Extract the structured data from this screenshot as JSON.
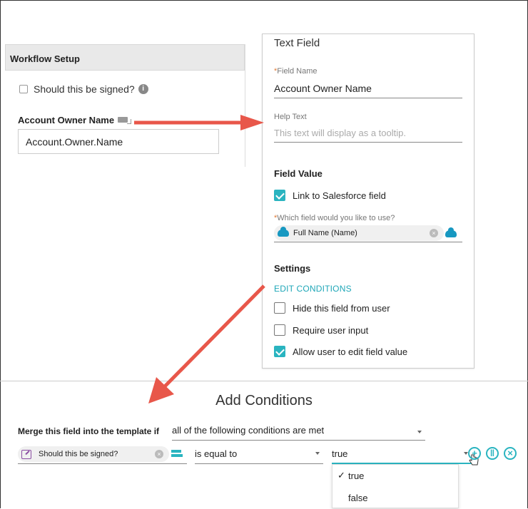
{
  "workflow": {
    "header": "Workflow Setup",
    "signed_label": "Should this be signed?",
    "field_label": "Account Owner Name",
    "field_value": "Account.Owner.Name"
  },
  "text_field": {
    "title": "Text Field",
    "field_name_label": "Field Name",
    "field_name_value": "Account Owner Name",
    "help_text_label": "Help Text",
    "help_text_placeholder": "This text will display as a tooltip.",
    "field_value_heading": "Field Value",
    "link_label": "Link to Salesforce field",
    "link_checked": true,
    "which_field_label": "Which field would you like to use?",
    "selected_field": "Full Name (Name)",
    "settings_heading": "Settings",
    "edit_conditions": "EDIT CONDITIONS",
    "options": [
      {
        "label": "Hide this field from user",
        "checked": false
      },
      {
        "label": "Require user input",
        "checked": false
      },
      {
        "label": "Allow user to edit field value",
        "checked": true
      }
    ]
  },
  "conditions": {
    "title": "Add Conditions",
    "merge_label": "Merge this field into the template if",
    "match_mode": "all of the following conditions are met",
    "field": "Should this be signed?",
    "operator": "is equal to",
    "value": "true",
    "value_options": [
      {
        "label": "true",
        "selected": true
      },
      {
        "label": "false",
        "selected": false
      }
    ]
  },
  "colors": {
    "accent": "#2ab4c0",
    "salesforce_blue": "#1798c1",
    "arrow_red": "#e8574a",
    "required": "#e07b39"
  },
  "icons": [
    "info-icon",
    "field-icon",
    "cloud-icon",
    "clear-icon",
    "edit-icon",
    "add-icon",
    "group-icon",
    "remove-icon",
    "hand-cursor-icon",
    "checkmark-icon"
  ]
}
